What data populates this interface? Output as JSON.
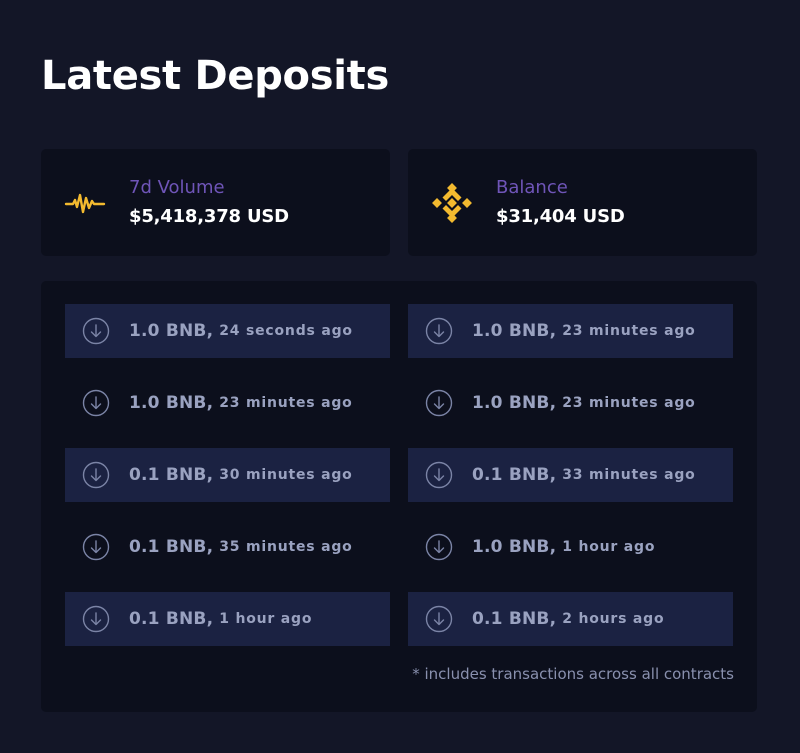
{
  "page": {
    "title": "Latest Deposits"
  },
  "stats": {
    "volume": {
      "label": "7d Volume",
      "value": "$5,418,378 USD",
      "icon": "pulse-icon",
      "icon_color": "#f3ba2f"
    },
    "balance": {
      "label": "Balance",
      "value": "$31,404 USD",
      "icon": "bnb-logo-icon",
      "icon_color": "#f3ba2f"
    }
  },
  "deposits": {
    "items": [
      {
        "amount": "1.0 BNB,",
        "time": "24 seconds ago"
      },
      {
        "amount": "1.0 BNB,",
        "time": "23 minutes ago"
      },
      {
        "amount": "1.0 BNB,",
        "time": "23 minutes ago"
      },
      {
        "amount": "1.0 BNB,",
        "time": "23 minutes ago"
      },
      {
        "amount": "0.1 BNB,",
        "time": "30 minutes ago"
      },
      {
        "amount": "0.1 BNB,",
        "time": "33 minutes ago"
      },
      {
        "amount": "0.1 BNB,",
        "time": "35 minutes ago"
      },
      {
        "amount": "1.0 BNB,",
        "time": "1 hour ago"
      },
      {
        "amount": "0.1 BNB,",
        "time": "1 hour ago"
      },
      {
        "amount": "0.1 BNB,",
        "time": "2 hours ago"
      }
    ],
    "footnote": "* includes transactions across all contracts"
  },
  "colors": {
    "background": "#131627",
    "card": "#0c0f1c",
    "row_highlight": "#1b2242",
    "accent_purple": "#6f55b8",
    "accent_gold": "#f3ba2f",
    "row_text": "#9aa2c0"
  }
}
